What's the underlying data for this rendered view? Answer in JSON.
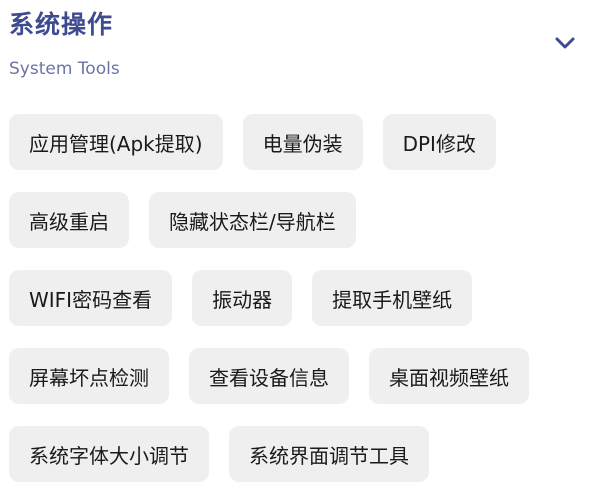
{
  "section": {
    "title": "系统操作",
    "subtitle": "System Tools",
    "toggle_icon": "chevron-down-icon",
    "accent_color": "#3f4b8f"
  },
  "tools": [
    [
      {
        "id": "app-manager",
        "label": "应用管理(Apk提取)"
      },
      {
        "id": "battery-spoof",
        "label": "电量伪装"
      },
      {
        "id": "dpi-modify",
        "label": "DPI修改"
      }
    ],
    [
      {
        "id": "advanced-reboot",
        "label": "高级重启"
      },
      {
        "id": "hide-bars",
        "label": "隐藏状态栏/导航栏"
      }
    ],
    [
      {
        "id": "wifi-password",
        "label": "WIFI密码查看"
      },
      {
        "id": "vibrator",
        "label": "振动器"
      },
      {
        "id": "extract-wallpaper",
        "label": "提取手机壁纸"
      }
    ],
    [
      {
        "id": "dead-pixel-test",
        "label": "屏幕坏点检测"
      },
      {
        "id": "device-info",
        "label": "查看设备信息"
      },
      {
        "id": "video-wallpaper",
        "label": "桌面视频壁纸"
      }
    ],
    [
      {
        "id": "font-size",
        "label": "系统字体大小调节"
      },
      {
        "id": "ui-adjust",
        "label": "系统界面调节工具"
      }
    ]
  ]
}
